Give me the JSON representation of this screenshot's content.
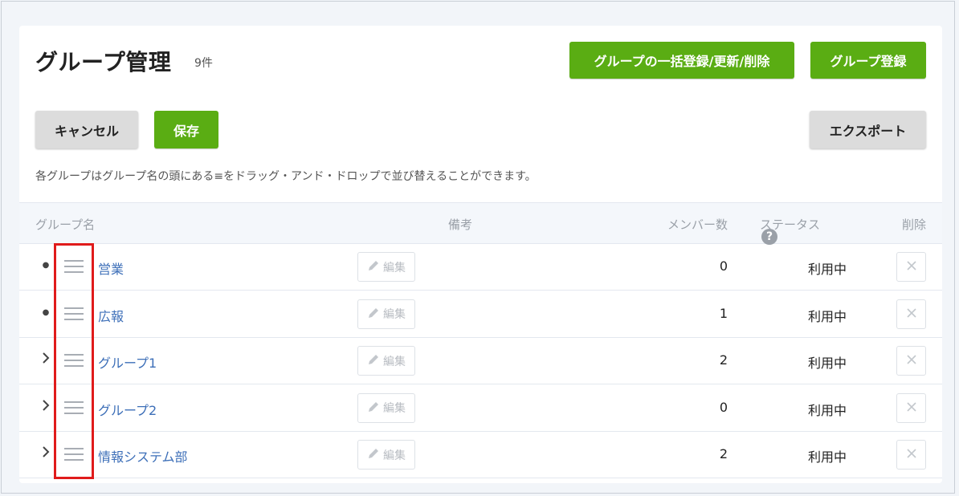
{
  "header": {
    "title": "グループ管理",
    "count": "9件",
    "bulk_button": "グループの一括登録/更新/削除",
    "register_button": "グループ登録"
  },
  "toolbar": {
    "cancel_label": "キャンセル",
    "save_label": "保存",
    "export_label": "エクスポート"
  },
  "hint": "各グループはグループ名の頭にある≡をドラッグ・アンド・ドロップで並び替えることができます。",
  "table": {
    "columns": {
      "name": "グループ名",
      "note": "備考",
      "members": "メンバー数",
      "status": "ステータス",
      "delete": "削除"
    },
    "edit_label": "編集",
    "rows": [
      {
        "lead": "dot",
        "name": "営業",
        "members": "0",
        "status": "利用中"
      },
      {
        "lead": "dot",
        "name": "広報",
        "members": "1",
        "status": "利用中"
      },
      {
        "lead": "chevron",
        "name": "グループ1",
        "members": "2",
        "status": "利用中"
      },
      {
        "lead": "chevron",
        "name": "グループ2",
        "members": "0",
        "status": "利用中"
      },
      {
        "lead": "chevron",
        "name": "情報システム部",
        "members": "2",
        "status": "利用中"
      }
    ]
  },
  "icons": {
    "help": "question-circle-icon",
    "drag": "drag-handle-icon",
    "edit": "pencil-icon",
    "delete": "close-icon",
    "expand": "chevron-right-icon"
  },
  "colors": {
    "accent_green": "#5aad13",
    "link_blue": "#3d6fb8",
    "highlight_red": "#e01b1b"
  }
}
